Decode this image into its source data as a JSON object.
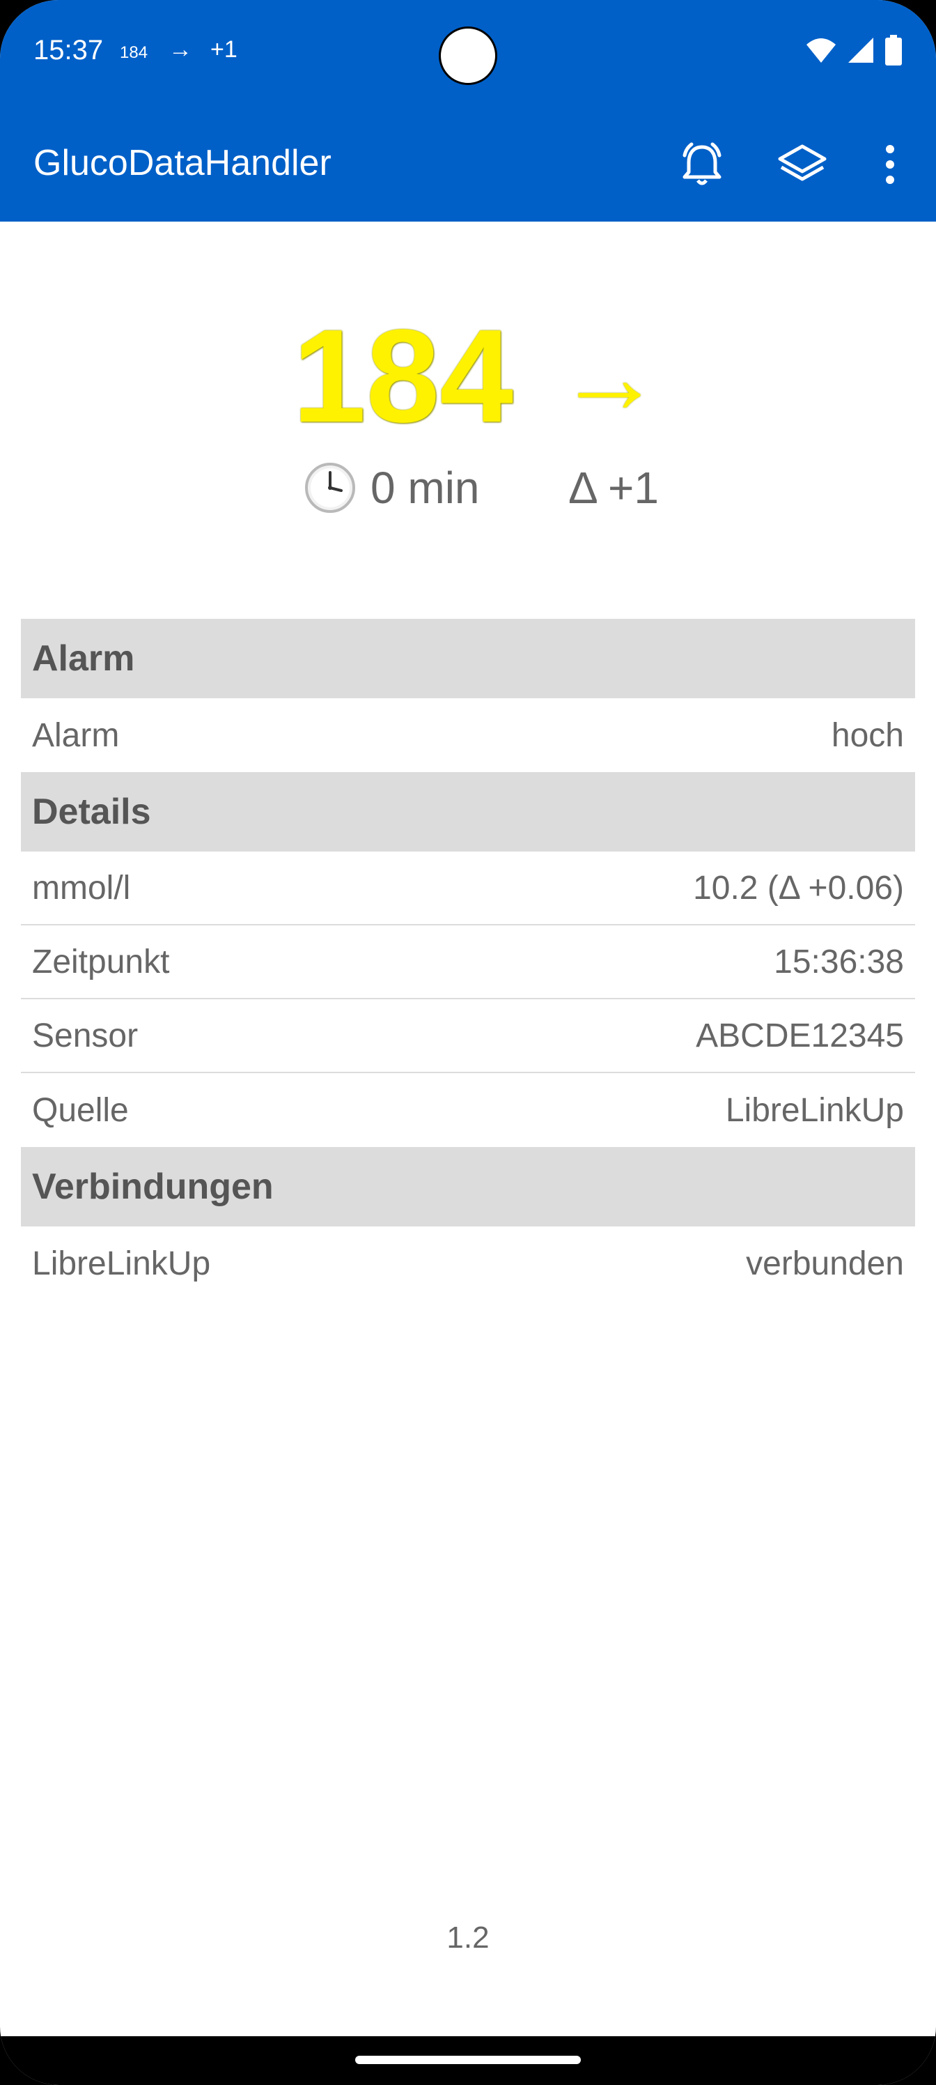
{
  "status_bar": {
    "time": "15:37",
    "glucose": "184",
    "arrow": "→",
    "delta": "+1",
    "icons": [
      "wifi-icon",
      "signal-icon",
      "battery-icon"
    ]
  },
  "app_bar": {
    "title": "GlucoDataHandler",
    "icons": [
      "alarm-bell-icon",
      "layers-icon",
      "more-vert-icon"
    ]
  },
  "glucose": {
    "value": "184",
    "trend_arrow": "→",
    "time_icon": "clock-icon",
    "time_ago": "0 min",
    "delta": "Δ +1"
  },
  "sections": [
    {
      "title": "Alarm",
      "rows": [
        {
          "label": "Alarm",
          "value": "hoch"
        }
      ]
    },
    {
      "title": "Details",
      "rows": [
        {
          "label": "mmol/l",
          "value": "10.2 (Δ +0.06)"
        },
        {
          "label": "Zeitpunkt",
          "value": "15:36:38"
        },
        {
          "label": "Sensor",
          "value": "ABCDE12345"
        },
        {
          "label": "Quelle",
          "value": "LibreLinkUp"
        }
      ]
    },
    {
      "title": "Verbindungen",
      "rows": [
        {
          "label": "LibreLinkUp",
          "value": "verbunden"
        }
      ]
    }
  ],
  "version": "1.2",
  "colors": {
    "app_bar": "#0060C8",
    "glucose": "#FFF200",
    "section_bg": "#DCDCDC",
    "text": "#666666"
  }
}
